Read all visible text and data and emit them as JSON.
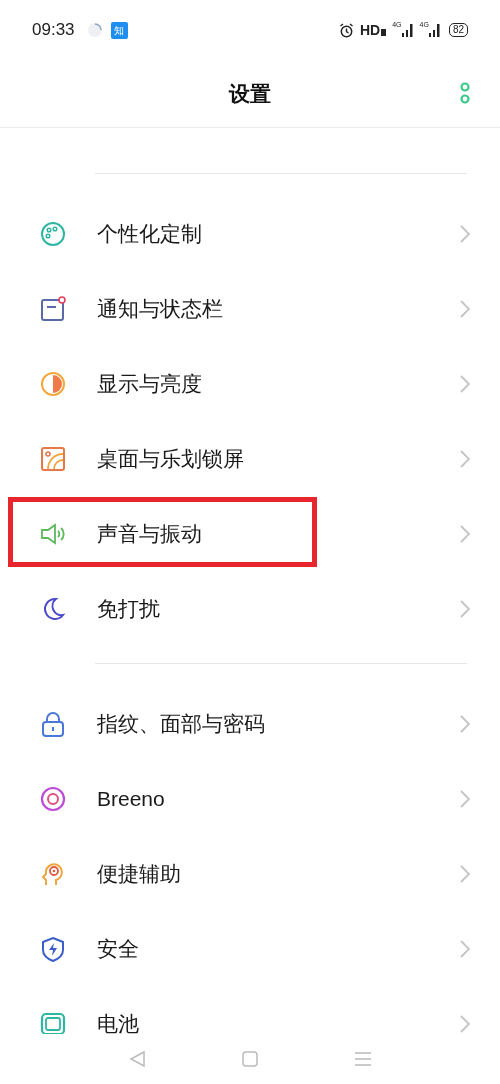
{
  "status_bar": {
    "time": "09:33",
    "app_badge": "知",
    "hd_label": "HD",
    "network_1": "4G",
    "network_2": "4G",
    "battery": "82"
  },
  "header": {
    "title": "设置"
  },
  "groups": [
    {
      "items": [
        {
          "label": "个性化定制",
          "highlighted": false
        },
        {
          "label": "通知与状态栏",
          "highlighted": false
        },
        {
          "label": "显示与亮度",
          "highlighted": false
        },
        {
          "label": "桌面与乐划锁屏",
          "highlighted": false
        },
        {
          "label": "声音与振动",
          "highlighted": true
        },
        {
          "label": "免打扰",
          "highlighted": false
        }
      ]
    },
    {
      "items": [
        {
          "label": "指纹、面部与密码",
          "highlighted": false
        },
        {
          "label": "Breeno",
          "highlighted": false
        },
        {
          "label": "便捷辅助",
          "highlighted": false
        },
        {
          "label": "安全",
          "highlighted": false
        },
        {
          "label": "电池",
          "highlighted": false
        }
      ]
    }
  ]
}
